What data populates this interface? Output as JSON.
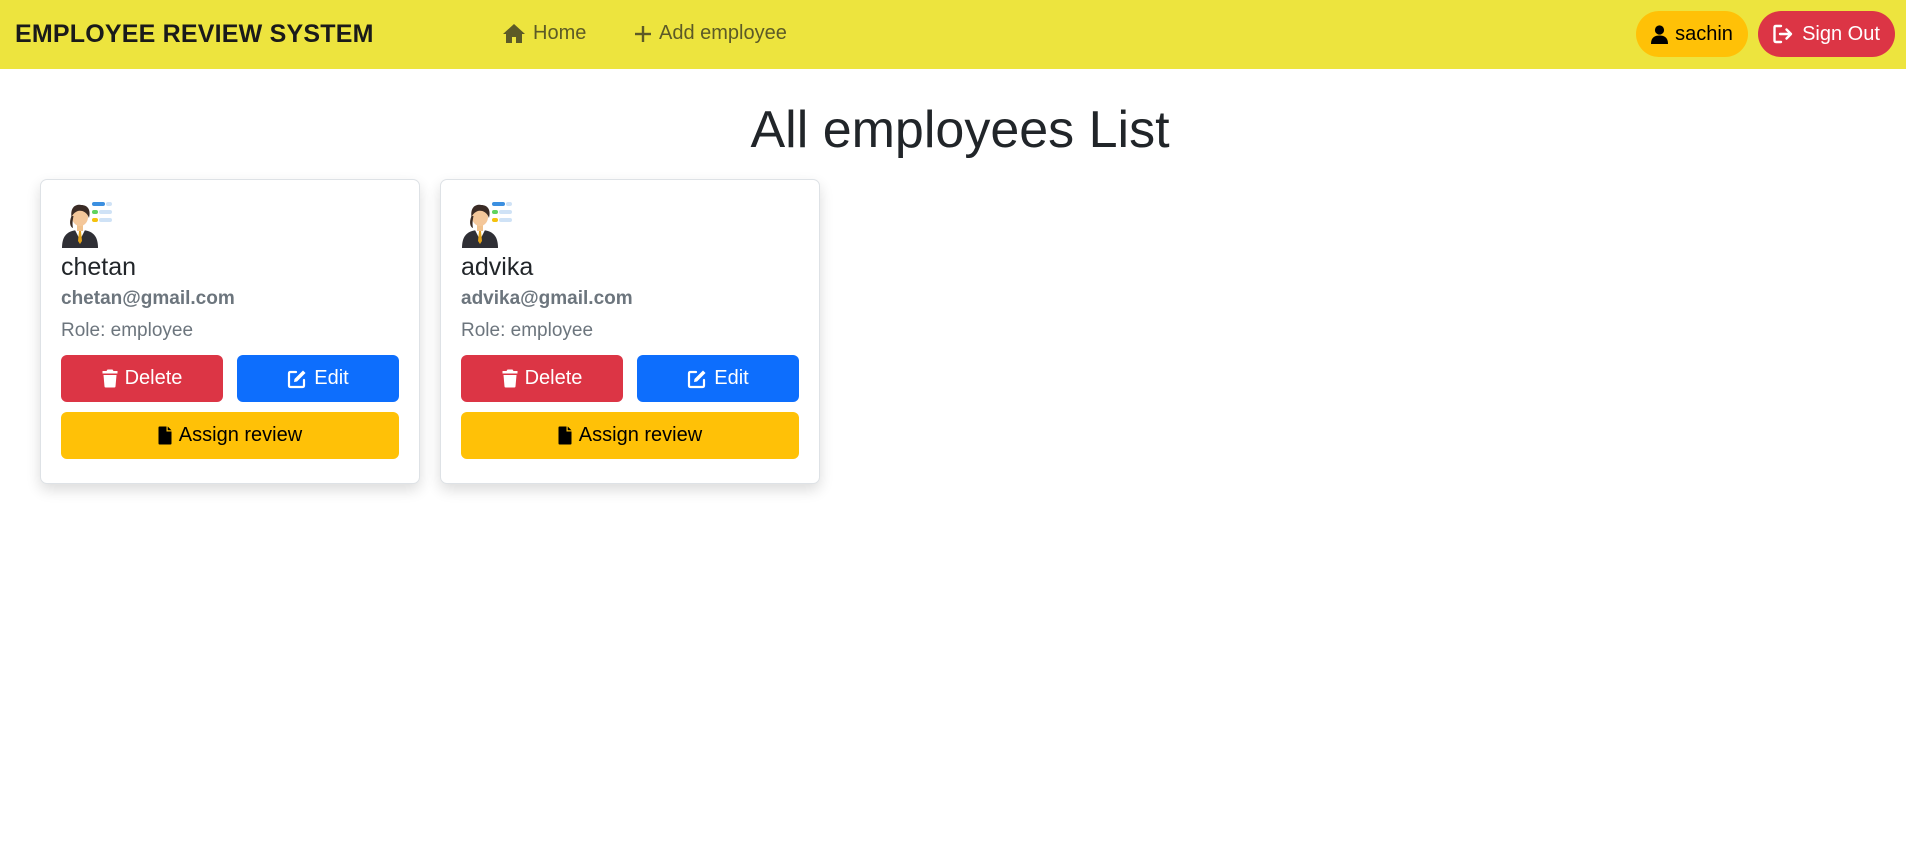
{
  "navbar": {
    "brand": "EMPLOYEE REVIEW SYSTEM",
    "home_label": "Home",
    "add_employee_label": "Add employee",
    "user_label": "sachin",
    "signout_label": "Sign Out",
    "colors": {
      "background": "#ede43e",
      "user": "#ffc107",
      "signout": "#dc3545"
    }
  },
  "page": {
    "title": "All employees List"
  },
  "employees": [
    {
      "name": "chetan",
      "email": "chetan@gmail.com",
      "role": "Role: employee",
      "delete_label": "Delete",
      "edit_label": "Edit",
      "assign_label": "Assign review"
    },
    {
      "name": "advika",
      "email": "advika@gmail.com",
      "role": "Role: employee",
      "delete_label": "Delete",
      "edit_label": "Edit",
      "assign_label": "Assign review"
    }
  ],
  "icons": [
    "home-icon",
    "plus-icon",
    "user-icon",
    "sign-out-icon",
    "employee-avatar-icon",
    "trash-icon",
    "edit-icon",
    "file-icon"
  ],
  "button_colors": {
    "delete": "#dc3545",
    "edit": "#0d6efd",
    "assign": "#ffc107"
  }
}
